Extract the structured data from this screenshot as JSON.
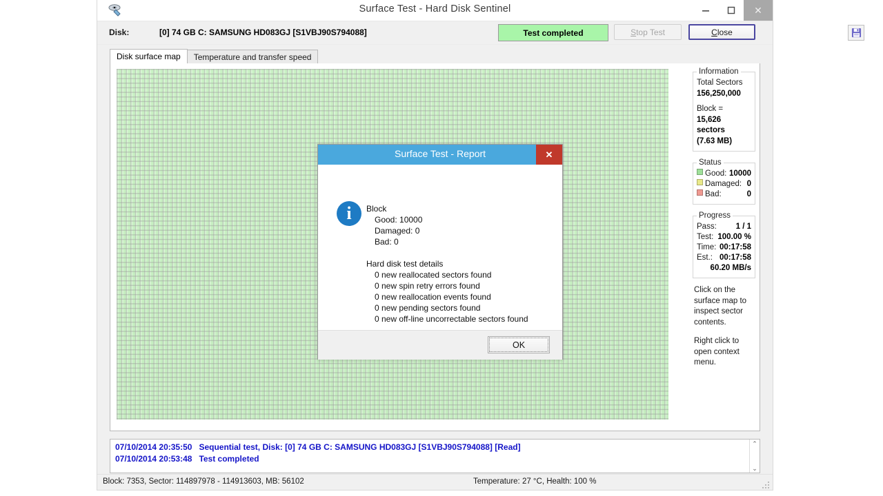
{
  "window": {
    "title": "Surface Test - Hard Disk Sentinel",
    "app_icon": "hard-disk-icon",
    "minimize_label": "–",
    "maximize_label": "❐",
    "close_label": "✕"
  },
  "toolbar": {
    "disk_label": "Disk:",
    "disk_value": "[0] 74 GB C: SAMSUNG HD083GJ [S1VBJ90S794088]",
    "status_text": "Test completed",
    "status_bg": "#a9f5a9",
    "stop_test_label": "Stop Test",
    "close_label": "Close",
    "save_icon": "floppy-save-icon"
  },
  "tabs": [
    {
      "label": "Disk surface map",
      "active": true
    },
    {
      "label": "Temperature and transfer speed",
      "active": false
    }
  ],
  "surface_map": {
    "good_color": "#c6f0c0",
    "grid_color": "#969696"
  },
  "information": {
    "legend": "Information",
    "total_sectors_label": "Total Sectors",
    "total_sectors_value": "156,250,000",
    "block_label": "Block =",
    "block_value": "15,626 sectors",
    "block_size": "(7.63 MB)"
  },
  "status": {
    "legend": "Status",
    "rows": [
      {
        "label": "Good:",
        "value": "10000",
        "color": "#9fe09a"
      },
      {
        "label": "Damaged:",
        "value": "0",
        "color": "#e9e98a"
      },
      {
        "label": "Bad:",
        "value": "0",
        "color": "#f09a92"
      }
    ]
  },
  "progress": {
    "legend": "Progress",
    "rows": [
      {
        "label": "Pass:",
        "value": "1 / 1"
      },
      {
        "label": "Test:",
        "value": "100.00 %"
      },
      {
        "label": "Time:",
        "value": "00:17:58"
      },
      {
        "label": "Est.:",
        "value": "00:17:58"
      }
    ],
    "speed": "60.20 MB/s"
  },
  "hints": {
    "first": "Click on the surface map to inspect sector contents.",
    "second": "Right click to open context menu."
  },
  "log": {
    "entries": [
      {
        "timestamp": "07/10/2014  20:35:50",
        "message": "Sequential test, Disk: [0] 74 GB C: SAMSUNG HD083GJ [S1VBJ90S794088] [Read]"
      },
      {
        "timestamp": "07/10/2014  20:53:48",
        "message": "Test completed"
      }
    ],
    "scroll_up": "⌃",
    "scroll_down": "⌄",
    "text_color": "#1414c8"
  },
  "statusbar": {
    "left": "Block: 7353, Sector: 114897978 - 114913603, MB: 56102",
    "right": "Temperature: 27  °C,  Health: 100 %"
  },
  "dialog": {
    "title": "Surface Test - Report",
    "close_label": "✕",
    "icon": "info-icon",
    "block_header": "Block",
    "block_good": "Good: 10000",
    "block_damaged": "Damaged: 0",
    "block_bad": "Bad: 0",
    "details_header": "Hard disk test details",
    "details": [
      "0 new reallocated sectors found",
      "0 new spin retry errors found",
      "0 new reallocation events found",
      "0 new pending sectors found",
      "0 new off-line uncorrectable sectors found"
    ],
    "ok_label": "OK",
    "title_bg": "#4aa8dd",
    "close_bg": "#c0392b"
  }
}
